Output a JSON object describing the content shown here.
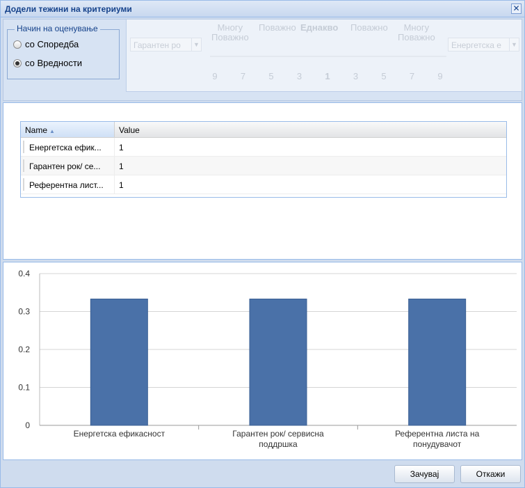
{
  "window": {
    "title": "Додели тежини на критериуми"
  },
  "rating_method": {
    "legend": "Начин на оценување",
    "options": [
      {
        "label": "со Споредба",
        "checked": false
      },
      {
        "label": "со Вредности",
        "checked": true
      }
    ]
  },
  "scale": {
    "left_combo": "Гарантен ро",
    "right_combo": "Енергетска е",
    "labels": [
      {
        "text": "Многу\nПоважно"
      },
      {
        "text": "Поважно"
      },
      {
        "text": "Еднакво",
        "bold": true
      },
      {
        "text": "Поважно"
      },
      {
        "text": "Многу\nПоважно"
      }
    ],
    "numbers": [
      "9",
      "7",
      "5",
      "3",
      "1",
      "3",
      "5",
      "7",
      "9"
    ]
  },
  "grid": {
    "columns": {
      "name": "Name",
      "value": "Value"
    },
    "rows": [
      {
        "name": "Енергетска ефик...",
        "value": "1"
      },
      {
        "name": "Гарантен рок/ се...",
        "value": "1"
      },
      {
        "name": "Референтна лист...",
        "value": "1"
      }
    ]
  },
  "chart_data": {
    "type": "bar",
    "categories": [
      "Енергетска ефикасност",
      "Гарантен рок/ сервисна поддршка",
      "Референтна листа на понудувачот"
    ],
    "category_lines": [
      [
        "Енергетска ефикасност"
      ],
      [
        "Гарантен рок/ сервисна",
        "поддршка"
      ],
      [
        "Референтна листа на",
        "понудувачот"
      ]
    ],
    "values": [
      0.333,
      0.333,
      0.333
    ],
    "ylim": [
      0,
      0.4
    ],
    "yticks": [
      "0",
      "0.1",
      "0.2",
      "0.3",
      "0.4"
    ],
    "grid": true,
    "bar_color": "#4a71a8"
  },
  "buttons": {
    "save": "Зачувај",
    "cancel": "Откажи"
  }
}
